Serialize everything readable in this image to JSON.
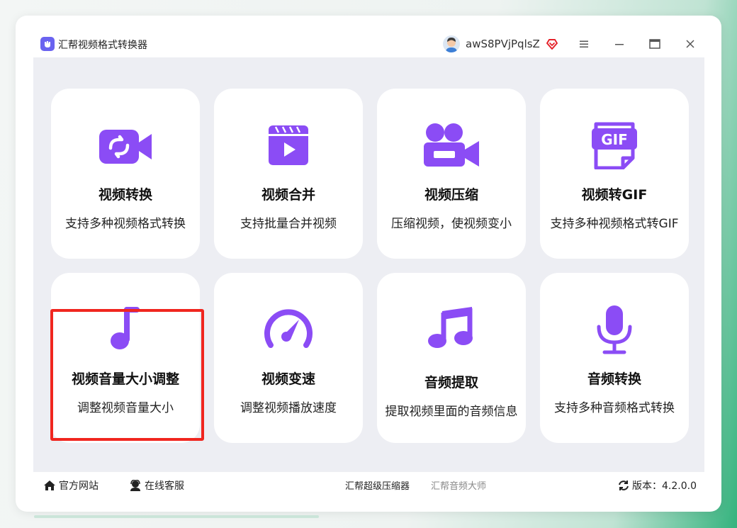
{
  "window": {
    "title": "汇帮视频格式转换器",
    "username": "awS8PVjPqlsZ"
  },
  "colors": {
    "accent": "#8b4cf5",
    "highlight": "#f0261f",
    "content_bg": "#edeef3"
  },
  "cards": [
    {
      "title": "视频转换",
      "desc": "支持多种视频格式转换",
      "icon": "video-convert-icon"
    },
    {
      "title": "视频合并",
      "desc": "支持批量合并视频",
      "icon": "video-merge-icon"
    },
    {
      "title": "视频压缩",
      "desc": "压缩视频，使视频变小",
      "icon": "video-compress-icon"
    },
    {
      "title": "视频转GIF",
      "desc": "支持多种视频格式转GIF",
      "icon": "gif-icon"
    },
    {
      "title": "视频音量大小调整",
      "desc": "调整视频音量大小",
      "icon": "music-note-icon"
    },
    {
      "title": "视频变速",
      "desc": "调整视频播放速度",
      "icon": "speedometer-icon"
    },
    {
      "title": "音频提取",
      "desc": "提取视频里面的音频信息",
      "icon": "music-notes-icon"
    },
    {
      "title": "音频转换",
      "desc": "支持多种音频格式转换",
      "icon": "microphone-icon"
    }
  ],
  "footer": {
    "website": "官方网站",
    "support": "在线客服",
    "link1": "汇帮超级压缩器",
    "link2": "汇帮音频大师",
    "version": "版本：4.2.0.0"
  }
}
